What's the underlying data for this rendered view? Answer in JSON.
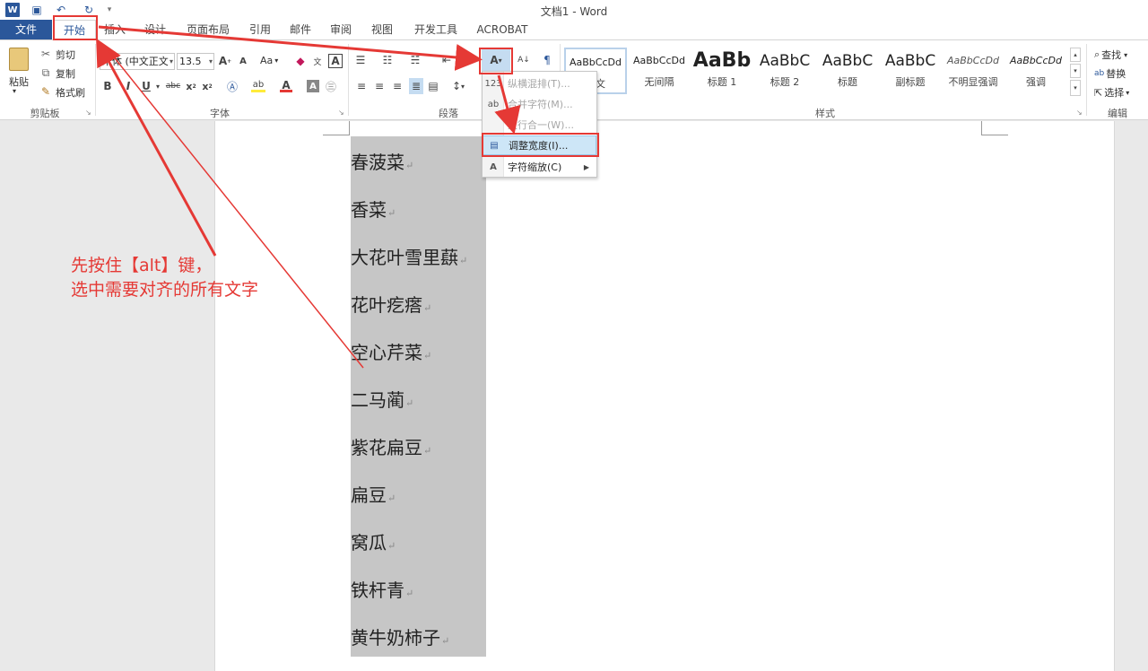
{
  "window": {
    "title": "文档1 - Word"
  },
  "tabs": [
    "文件",
    "开始",
    "插入",
    "设计",
    "页面布局",
    "引用",
    "邮件",
    "审阅",
    "视图",
    "开发工具",
    "ACROBAT"
  ],
  "clipboard": {
    "paste": "粘贴",
    "cut": "剪切",
    "copy": "复制",
    "format_painter": "格式刷",
    "group_label": "剪贴板"
  },
  "font": {
    "name": "宋体 (中文正文",
    "size": "13.5",
    "change_case": "Aa",
    "group_label": "字体"
  },
  "paragraph": {
    "group_label": "段落"
  },
  "styles": {
    "group_label": "样式",
    "items": [
      {
        "sample": "AaBbCcDd",
        "name": "正文"
      },
      {
        "sample": "AaBbCcDd",
        "name": "无间隔"
      },
      {
        "sample": "AaBb",
        "name": "标题 1"
      },
      {
        "sample": "AaBbC",
        "name": "标题 2"
      },
      {
        "sample": "AaBbC",
        "name": "标题"
      },
      {
        "sample": "AaBbC",
        "name": "副标题"
      },
      {
        "sample": "AaBbCcDd",
        "name": "不明显强调"
      },
      {
        "sample": "AaBbCcDd",
        "name": "强调"
      }
    ]
  },
  "editing": {
    "find": "查找",
    "replace": "替换",
    "select": "选择",
    "group_label": "编辑"
  },
  "dropdown_menu": {
    "items": [
      {
        "icon": "123",
        "label": "纵横混排(T)...",
        "disabled": true
      },
      {
        "icon": "ab",
        "label": "合并字符(M)...",
        "disabled": true
      },
      {
        "icon": "",
        "label": "双行合一(W)...",
        "disabled": true
      },
      {
        "icon": "▤",
        "label": "调整宽度(I)...",
        "highlighted": true
      },
      {
        "icon": "A",
        "label": "字符缩放(C)",
        "submenu": true
      }
    ]
  },
  "document": {
    "lines": [
      "春菠菜",
      "香菜",
      "大花叶雪里蕻",
      "花叶疙瘩",
      "空心芹菜",
      "二马蔺",
      "紫花扁豆",
      "扁豆",
      "窝瓜",
      "铁杆青",
      "黄牛奶柿子"
    ],
    "para_mark": "↵"
  },
  "annotation": {
    "line1": "先按住【alt】键，",
    "line2": "选中需要对齐的所有文字",
    "color": "#e53935"
  },
  "colors": {
    "word_blue": "#2b579a",
    "selection": "#c6c6c6"
  }
}
